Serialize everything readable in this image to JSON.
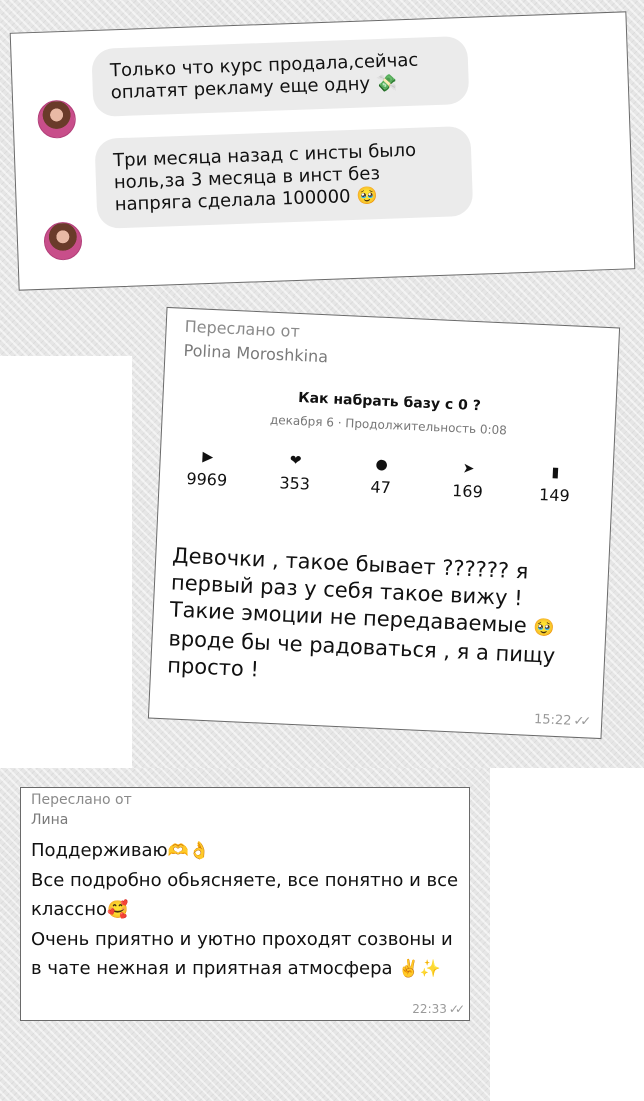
{
  "chat1": {
    "messages": [
      {
        "text": "Только что курс продала,сейчас оплатят рекламу еще одну",
        "emoji": "💸"
      },
      {
        "text": "Три месяца назад с инсты было ноль,за 3 месяца в инст без напряга сделала 100000",
        "emoji": "🥹"
      }
    ]
  },
  "post": {
    "forwarded_label": "Переслано от",
    "forwarded_from": "Polina Moroshkina",
    "video_title": "Как набрать базу с 0 ?",
    "video_meta": "декабря 6 · Продолжительность 0:08",
    "stats": [
      {
        "icon": "play-icon",
        "glyph": "▶",
        "value": "9969"
      },
      {
        "icon": "heart-icon",
        "glyph": "❤",
        "value": "353"
      },
      {
        "icon": "comment-icon",
        "glyph": "●",
        "value": "47"
      },
      {
        "icon": "send-icon",
        "glyph": "➤",
        "value": "169"
      },
      {
        "icon": "bookmark-icon",
        "glyph": "▮",
        "value": "149"
      }
    ],
    "message_a": "Девочки , такое бывает ?????? я первый раз у себя такое вижу ! Такие эмоции не передаваемые",
    "emoji": "🥹",
    "message_b": "вроде бы че радоваться , я а пищу просто !",
    "time": "15:22"
  },
  "review": {
    "forwarded_label": "Переслано от",
    "forwarded_from": "Лина",
    "line1": "Поддерживаю",
    "line1_emoji": "🫶👌",
    "line2": "Все подробно обьясняете, все понятно и все классно",
    "line2_emoji": "🥰",
    "line3": "Очень приятно и уютно проходят созвоны и в чате нежная и приятная атмосфера",
    "line3_emoji": "✌️✨",
    "time": "22:33"
  }
}
